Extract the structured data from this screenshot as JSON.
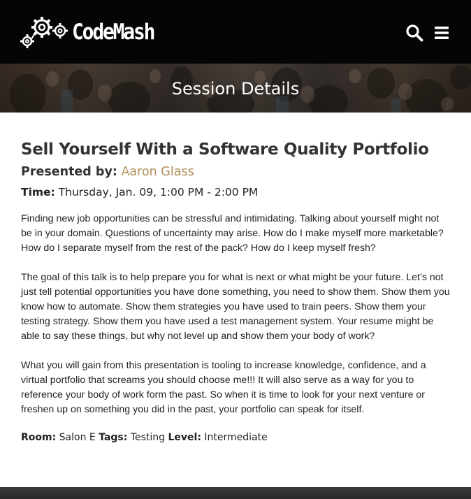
{
  "header": {
    "logo_text": "CodeMash",
    "search_icon": "search-icon",
    "menu_icon": "hamburger-menu-icon"
  },
  "hero": {
    "title": "Session Details"
  },
  "session": {
    "title": "Sell Yourself With a Software Quality Portfolio",
    "presented_by_label": "Presented by:",
    "presenter": "Aaron Glass",
    "time_label": "Time:",
    "time_value": "Thursday, Jan. 09, 1:00 PM - 2:00 PM",
    "abstract": [
      "Finding new job opportunities can be stressful and intimidating. Talking about yourself might not be in your domain. Questions of uncertainty may arise. How do I make myself more marketable? How do I separate myself from the rest of the pack? How do I keep myself fresh?",
      "The goal of this talk is to help prepare you for what is next or what might be your future. Let’s not just tell potential opportunities you have done something, you need to show them. Show them you know how to automate. Show them strategies you have used to train peers. Show them your testing strategy. Show them you have used a test management system. Your resume might be able to say these things, but why not level up and show them your body of work?",
      "What you will gain from this presentation is tooling to increase knowledge, confidence, and a virtual portfolio that screams you should choose me!!! It will also serve as a way for you to reference your body of work form the past. So when it is time to look for your next venture or freshen up on something you did in the past, your portfolio can speak for itself."
    ],
    "room_label": "Room:",
    "room_value": "Salon E",
    "tags_label": "Tags:",
    "tags_value": "Testing",
    "level_label": "Level:",
    "level_value": "Intermediate"
  },
  "colors": {
    "header_bg": "#050505",
    "presenter_link": "#b08f5a",
    "text": "#222222",
    "heading": "#333333"
  }
}
